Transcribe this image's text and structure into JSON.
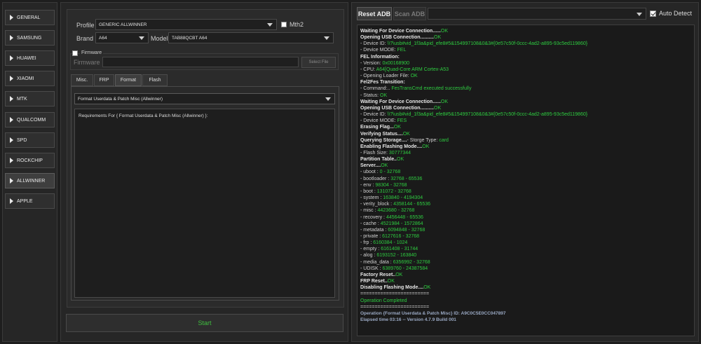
{
  "sidebar": {
    "items": [
      "GENERAL",
      "SAMSUNG",
      "HUAWEI",
      "XIAOMI",
      "MTK",
      "QUALCOMM",
      "SPD",
      "ROCKCHIP",
      "ALLWINNER",
      "APPLE"
    ],
    "active": "ALLWINNER"
  },
  "form": {
    "profile_label": "Profile",
    "profile_value": "GENERIC ALLWINNER",
    "mth2_label": "Mth2",
    "brand_label": "Brand",
    "brand_value": "A64",
    "model_label": "Model",
    "model_value": "TAB88QCBT A64",
    "firmware_group_label": "Firmware",
    "firmware_label": "Firmware",
    "firmware_value": "",
    "select_file_label": "Select File"
  },
  "tabs": [
    "Misc.",
    "FRP",
    "Format",
    "Flash"
  ],
  "active_tab": "Format",
  "operation": {
    "selected": "Format Userdata & Patch Misc (Allwinner)",
    "requirements_text": "Requirements For { Format Userdata & Patch Misc (Allwinner) }:"
  },
  "start_label": "Start",
  "colors": {
    "accent_green": "#2ecc40",
    "start_green": "#3fbf3f"
  },
  "right": {
    "reset_adb_label": "Reset ADB",
    "scan_adb_label": "Scan ADB",
    "device_value": "",
    "auto_detect_label": "Auto Detect",
    "auto_detect_checked": true
  },
  "log": [
    [
      [
        "b",
        "Waiting For Device Connection......"
      ],
      [
        "g",
        "OK"
      ]
    ],
    [
      [
        "b",
        "Opening USB Connection.........."
      ],
      [
        "g",
        "OK"
      ]
    ],
    [
      [
        "n",
        "- Device ID: "
      ],
      [
        "g",
        "\\\\?\\usb#vid_1f3a&pid_efe8#5&154997108&0&3#{0e57c50f-0ccc-4ad2-a895-93c5ed119860}"
      ]
    ],
    [
      [
        "n",
        "- Device MODE: "
      ],
      [
        "g",
        "FEL"
      ]
    ],
    [
      [
        "b",
        "FEL Information:"
      ]
    ],
    [
      [
        "n",
        "- Version: "
      ],
      [
        "g",
        "0x00168900"
      ]
    ],
    [
      [
        "n",
        "- CPU: "
      ],
      [
        "g",
        "A64[Quad-Core ARM Cortex-A53"
      ]
    ],
    [
      [
        "n",
        "- Opening Loader File: "
      ],
      [
        "g",
        "OK"
      ]
    ],
    [
      [
        "b",
        "Fel2Fes Transition:"
      ]
    ],
    [
      [
        "n",
        "- Command:.. "
      ],
      [
        "g",
        "FesTransCmd executed successfully"
      ]
    ],
    [
      [
        "n",
        "- Status: "
      ],
      [
        "g",
        "OK"
      ]
    ],
    [
      [
        "b",
        "Waiting For Device Connection......"
      ],
      [
        "g",
        "OK"
      ]
    ],
    [
      [
        "b",
        "Opening USB Connection.........."
      ],
      [
        "g",
        "OK"
      ]
    ],
    [
      [
        "n",
        "- Device ID: "
      ],
      [
        "g",
        "\\\\?\\usb#vid_1f3a&pid_efe8#5&154997108&0&3#{0e57c50f-0ccc-4ad2-a895-93c5ed119860}"
      ]
    ],
    [
      [
        "n",
        "- Device MODE: "
      ],
      [
        "g",
        "FES"
      ]
    ],
    [
      [
        "b",
        "Erasing Flag..."
      ],
      [
        "g",
        "OK"
      ]
    ],
    [
      [
        "b",
        "Verifying Status...."
      ],
      [
        "g",
        "OK"
      ]
    ],
    [
      [
        "b",
        "Querying Storage...."
      ],
      [
        "n",
        "- Storge Type: "
      ],
      [
        "g",
        "card"
      ]
    ],
    [
      [
        "b",
        "Enabling Flashing Mode...."
      ],
      [
        "g",
        "OK"
      ]
    ],
    [
      [
        "n",
        "- Flash Size: "
      ],
      [
        "g",
        "30777344"
      ]
    ],
    [
      [
        "b",
        "Partition Table.."
      ],
      [
        "g",
        "OK"
      ]
    ],
    [
      [
        "b",
        "Server...."
      ],
      [
        "g",
        "OK"
      ]
    ],
    [
      [
        "n",
        "- uboot : "
      ],
      [
        "g",
        "0 - 32768"
      ]
    ],
    [
      [
        "n",
        "- bootloader : "
      ],
      [
        "g",
        "32768 - 65536"
      ]
    ],
    [
      [
        "n",
        "- env : "
      ],
      [
        "g",
        "98304 - 32768"
      ]
    ],
    [
      [
        "n",
        "- boot : "
      ],
      [
        "g",
        "131072 - 32768"
      ]
    ],
    [
      [
        "n",
        "- system : "
      ],
      [
        "g",
        "163840 - 4194304"
      ]
    ],
    [
      [
        "n",
        "- verity_block : "
      ],
      [
        "g",
        "4358144 - 65536"
      ]
    ],
    [
      [
        "n",
        "- misc : "
      ],
      [
        "g",
        "4423680 - 32768"
      ]
    ],
    [
      [
        "n",
        "- recovery : "
      ],
      [
        "g",
        "4456448 - 65536"
      ]
    ],
    [
      [
        "n",
        "- cache : "
      ],
      [
        "g",
        "4521984 - 1572864"
      ]
    ],
    [
      [
        "n",
        "- metadata : "
      ],
      [
        "g",
        "6094848 - 32768"
      ]
    ],
    [
      [
        "n",
        "- private : "
      ],
      [
        "g",
        "6127616 - 32768"
      ]
    ],
    [
      [
        "n",
        "- frp : "
      ],
      [
        "g",
        "6160384 - 1024"
      ]
    ],
    [
      [
        "n",
        "- empty : "
      ],
      [
        "g",
        "6161408 - 31744"
      ]
    ],
    [
      [
        "n",
        "- alog : "
      ],
      [
        "g",
        "6193152 - 163840"
      ]
    ],
    [
      [
        "n",
        "- media_data : "
      ],
      [
        "g",
        "6356992 - 32768"
      ]
    ],
    [
      [
        "n",
        "- UDISK : "
      ],
      [
        "g",
        "6389760 - 24387584"
      ]
    ],
    [
      [
        "b",
        "Factory Reset.."
      ],
      [
        "g",
        "OK"
      ]
    ],
    [
      [
        "b",
        "FRP Reset.."
      ],
      [
        "g",
        "OK"
      ]
    ],
    [
      [
        "b",
        "Disabling Flashing Mode...."
      ],
      [
        "g",
        "OK"
      ]
    ],
    [
      [
        "n",
        "========================"
      ]
    ],
    [
      [
        "g",
        "Operation Completed"
      ]
    ],
    [
      [
        "n",
        "========================"
      ]
    ],
    [
      [
        "f",
        "Operation {Format Userdata & Patch Misc} ID: A9C0C5E0CC047897"
      ]
    ],
    [
      [
        "f",
        "Elapsed time 03:16 -- Version 4.7.9 Build 001"
      ]
    ]
  ]
}
